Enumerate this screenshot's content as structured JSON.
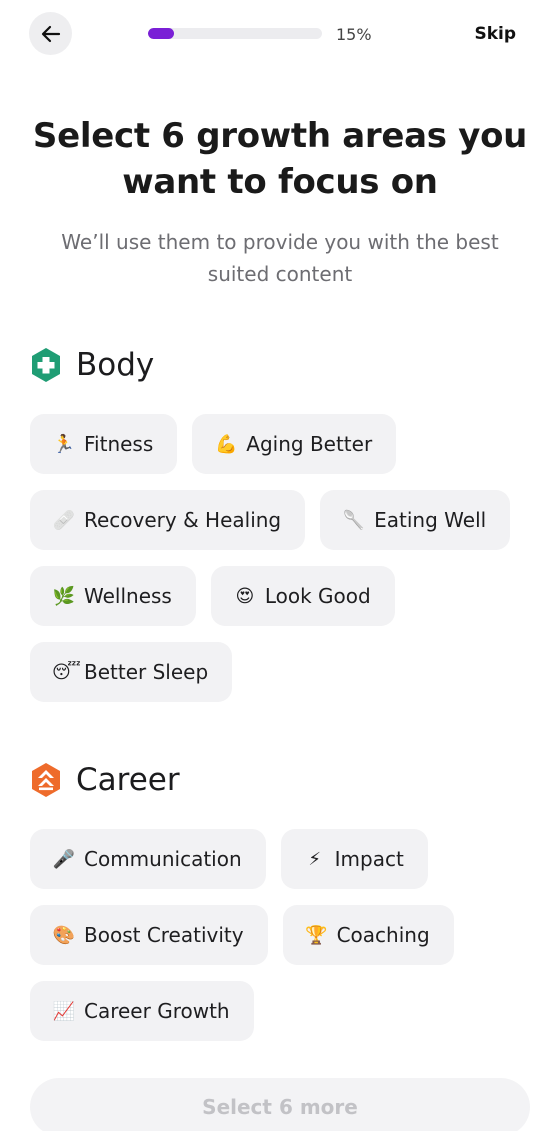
{
  "header": {
    "progress_percent": 15,
    "progress_text": "15%",
    "skip_label": "Skip"
  },
  "title": "Select 6 growth areas you want to focus on",
  "subtitle": "We’ll use them to provide you with the best suited content",
  "sections": [
    {
      "label": "Body",
      "icon": "body-shield-icon",
      "color": "#1f9d74",
      "chips": [
        {
          "emoji": "🏃",
          "label": "Fitness"
        },
        {
          "emoji": "💪",
          "label": "Aging Better"
        },
        {
          "emoji": "🩹",
          "label": "Recovery & Healing"
        },
        {
          "emoji": "🥄",
          "label": "Eating Well"
        },
        {
          "emoji": "🌿",
          "label": "Wellness"
        },
        {
          "emoji": "😍",
          "label": "Look Good"
        },
        {
          "emoji": "😴",
          "label": "Better Sleep"
        }
      ]
    },
    {
      "label": "Career",
      "icon": "career-arrows-icon",
      "color": "#ee6b2b",
      "chips": [
        {
          "emoji": "🎤",
          "label": "Communication"
        },
        {
          "emoji": "⚡",
          "label": "Impact"
        },
        {
          "emoji": "🎨",
          "label": "Boost Creativity"
        },
        {
          "emoji": "🏆",
          "label": "Coaching"
        },
        {
          "emoji": "📈",
          "label": "Career Growth"
        }
      ]
    }
  ],
  "cta_label": "Select 6 more"
}
